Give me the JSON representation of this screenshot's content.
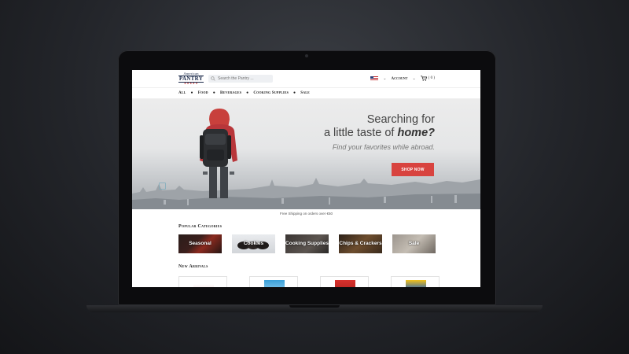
{
  "site": {
    "logo": {
      "line1": "American",
      "line2": "PANTRY",
      "line3": "★★★★★"
    },
    "search_placeholder": "Search the Pantry ...",
    "account_label": "Account",
    "cart_count": "( 0 )",
    "nav": [
      "All",
      "Food",
      "Beverages",
      "Cooking Supplies",
      "Sale"
    ],
    "hero": {
      "line1": "Searching for",
      "line2_prefix": "a little taste of ",
      "line2_emph": "home?",
      "subtitle": "Find your favorites while abroad.",
      "cta": "SHOP NOW"
    },
    "shipping_note": "Free Shipping on orders over €50",
    "popular_title": "Popular Categories",
    "categories": [
      "Seasonal",
      "Cookies",
      "Cooking Supplies",
      "Chips & Crackers",
      "Sale"
    ],
    "new_arrivals_title": "New Arrivals",
    "colors": {
      "accent": "#d8433f",
      "navy": "#1b2a4a"
    }
  }
}
